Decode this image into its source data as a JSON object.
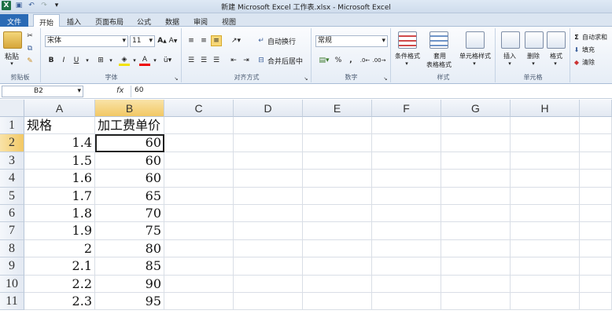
{
  "window": {
    "title": "新建 Microsoft Excel 工作表.xlsx - Microsoft Excel"
  },
  "tabs": [
    "文件",
    "开始",
    "插入",
    "页面布局",
    "公式",
    "数据",
    "审阅",
    "视图"
  ],
  "ribbon": {
    "clipboard": {
      "label": "剪贴板",
      "paste": "粘贴"
    },
    "font": {
      "label": "字体",
      "name": "宋体",
      "size": "11",
      "bold": "B",
      "italic": "I",
      "underline": "U"
    },
    "alignment": {
      "label": "对齐方式",
      "wrap": "自动换行",
      "merge": "合并后居中"
    },
    "number": {
      "label": "数字",
      "format": "常规",
      "percent": "%",
      "comma": ","
    },
    "styles": {
      "label": "样式",
      "conditional_line1": "条件格式",
      "table_line1": "套用",
      "table_line2": "表格格式",
      "cell_styles": "单元格样式"
    },
    "cells": {
      "label": "单元格",
      "insert": "插入",
      "delete": "删除",
      "format": "格式"
    },
    "editing": {
      "autosum": "自动求和",
      "fill": "填充",
      "clear": "清除"
    }
  },
  "formula_bar": {
    "name_box": "B2",
    "fx": "fx",
    "value": "60"
  },
  "columns": [
    "A",
    "B",
    "C",
    "D",
    "E",
    "F",
    "G",
    "H"
  ],
  "rows": [
    {
      "num": "1",
      "a": "规格",
      "b": "加工费单价"
    },
    {
      "num": "2",
      "a": "1.4",
      "b": "60"
    },
    {
      "num": "3",
      "a": "1.5",
      "b": "60"
    },
    {
      "num": "4",
      "a": "1.6",
      "b": "60"
    },
    {
      "num": "5",
      "a": "1.7",
      "b": "65"
    },
    {
      "num": "6",
      "a": "1.8",
      "b": "70"
    },
    {
      "num": "7",
      "a": "1.9",
      "b": "75"
    },
    {
      "num": "8",
      "a": "2",
      "b": "80"
    },
    {
      "num": "9",
      "a": "2.1",
      "b": "85"
    },
    {
      "num": "10",
      "a": "2.2",
      "b": "90"
    },
    {
      "num": "11",
      "a": "2.3",
      "b": "95"
    }
  ]
}
